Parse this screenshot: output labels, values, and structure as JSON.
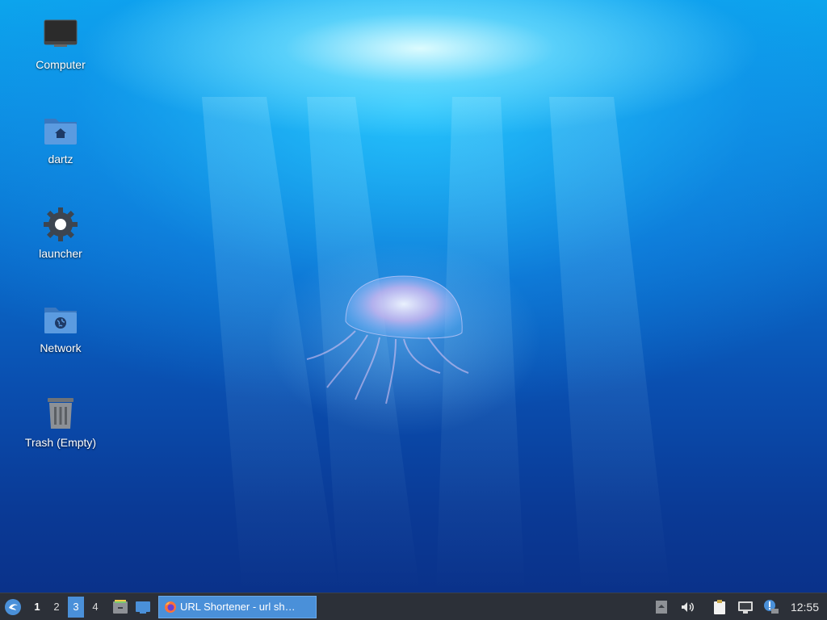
{
  "desktop": {
    "icons": [
      {
        "label": "Computer",
        "icon": "computer-icon"
      },
      {
        "label": "dartz",
        "icon": "home-folder-icon"
      },
      {
        "label": "launcher",
        "icon": "gear-icon"
      },
      {
        "label": "Network",
        "icon": "network-folder-icon"
      },
      {
        "label": "Trash (Empty)",
        "icon": "trash-icon"
      }
    ]
  },
  "taskbar": {
    "menu_icon": "distro-menu-icon",
    "workspaces": [
      "1",
      "2",
      "3",
      "4"
    ],
    "active_workspace": "3",
    "launchers": [
      "file-manager-icon",
      "show-desktop-icon"
    ],
    "tasks": [
      {
        "title": "URL Shortener - url sh…",
        "icon": "firefox-icon"
      }
    ],
    "tray": [
      "tray-arrow-icon",
      "volume-icon",
      "clipboard-icon",
      "network-wired-icon",
      "notification-icon"
    ],
    "clock": "12:55"
  },
  "colors": {
    "taskbar_bg": "#2c3038",
    "accent": "#4a90d9",
    "folder_blue": "#4a8fd8"
  }
}
